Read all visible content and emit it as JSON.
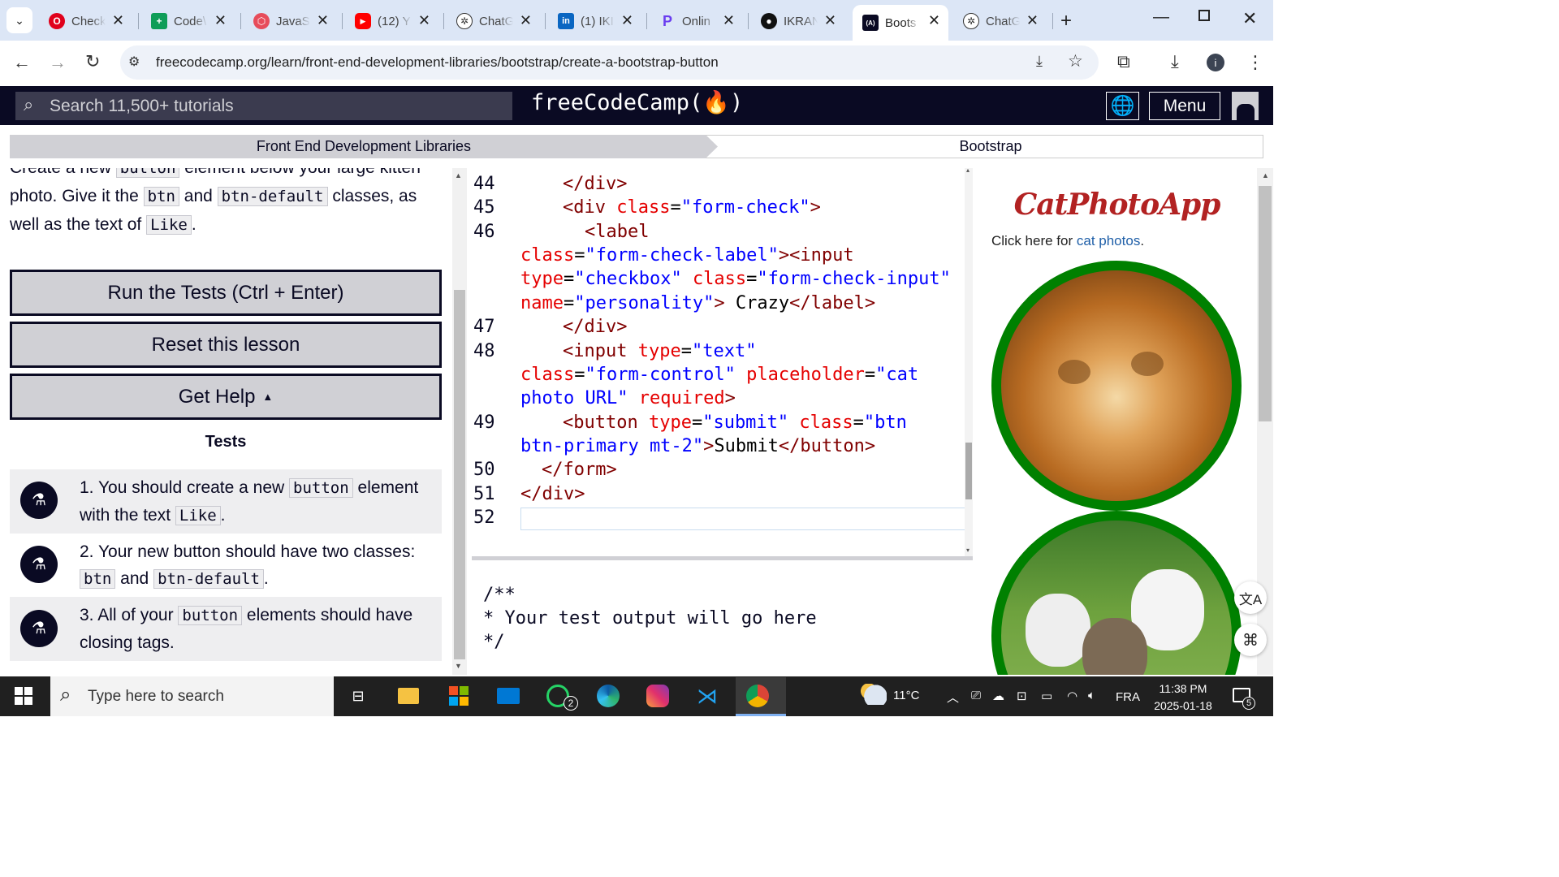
{
  "browser": {
    "tabs": [
      {
        "title": "Check",
        "icon": "opera-icon",
        "color": "#e0001b",
        "glyph": "O"
      },
      {
        "title": "Code\\",
        "icon": "sheets-icon",
        "color": "#0f9d58",
        "glyph": "+"
      },
      {
        "title": "JavaS",
        "icon": "javascript-site-icon",
        "color": "#e74c5b",
        "glyph": "⬡"
      },
      {
        "title": "(12) Y",
        "icon": "youtube-icon",
        "color": "#ff0000",
        "glyph": "▶"
      },
      {
        "title": "ChatG",
        "icon": "chatgpt-icon",
        "color": "#444444",
        "glyph": "✲"
      },
      {
        "title": "(1) IKI",
        "icon": "linkedin-icon",
        "color": "#0a66c2",
        "glyph": "in"
      },
      {
        "title": "Onlin",
        "icon": "online-site-icon",
        "color": "#6a3df0",
        "glyph": "P"
      },
      {
        "title": "IKRAN",
        "icon": "github-icon",
        "color": "#111111",
        "glyph": "●"
      },
      {
        "title": "Boots",
        "icon": "freecodecamp-icon",
        "color": "#0a0a23",
        "glyph": "(A)"
      },
      {
        "title": "ChatG",
        "icon": "chatgpt-icon",
        "color": "#444444",
        "glyph": "✲"
      }
    ],
    "url": "freecodecamp.org/learn/front-end-development-libraries/bootstrap/create-a-bootstrap-button"
  },
  "fcc": {
    "search_placeholder": "Search 11,500+ tutorials",
    "logo": "freeCodeCamp(🔥)",
    "menu_label": "Menu"
  },
  "breadcrumb": {
    "left": "Front End Development Libraries",
    "right": "Bootstrap"
  },
  "lesson": {
    "line1_a": "Create a new",
    "line1_code": "button",
    "line1_b": "element below your large kitten",
    "line2_a": "photo. Give it the",
    "line2_code1": "btn",
    "line2_and": "and",
    "line2_code2": "btn-default",
    "line2_b": "classes, as",
    "line3_a": "well as the text of",
    "line3_code": "Like",
    "line3_b": ".",
    "run_tests": "Run the Tests (Ctrl + Enter)",
    "reset": "Reset this lesson",
    "get_help": "Get Help",
    "tests_heading": "Tests",
    "tests": [
      {
        "a": "1. You should create a new",
        "code": "button",
        "b": "element",
        "c": "with the text",
        "code2": "Like",
        "d": "."
      },
      {
        "a": "2. Your new button should have two classes:",
        "code": "btn",
        "b": "and",
        "code2": "btn-default",
        "d": "."
      },
      {
        "a": "3. All of your",
        "code": "button",
        "b": "elements should have",
        "c": "closing tags."
      }
    ]
  },
  "editor": {
    "line_numbers": [
      "44",
      "45",
      "46",
      "47",
      "48",
      "49",
      "50",
      "51",
      "52"
    ],
    "console": [
      "/**",
      "* Your test output will go here",
      "*/"
    ]
  },
  "preview": {
    "title": "CatPhotoApp",
    "link_prefix": "Click here for",
    "link_text": "cat photos",
    "link_suffix": "."
  },
  "taskbar": {
    "search_placeholder": "Type here to search",
    "weather": "11°C",
    "language": "FRA",
    "time": "11:38 PM",
    "date": "2025-01-18",
    "whatsapp_badge": "2",
    "notif_badge": "5"
  }
}
